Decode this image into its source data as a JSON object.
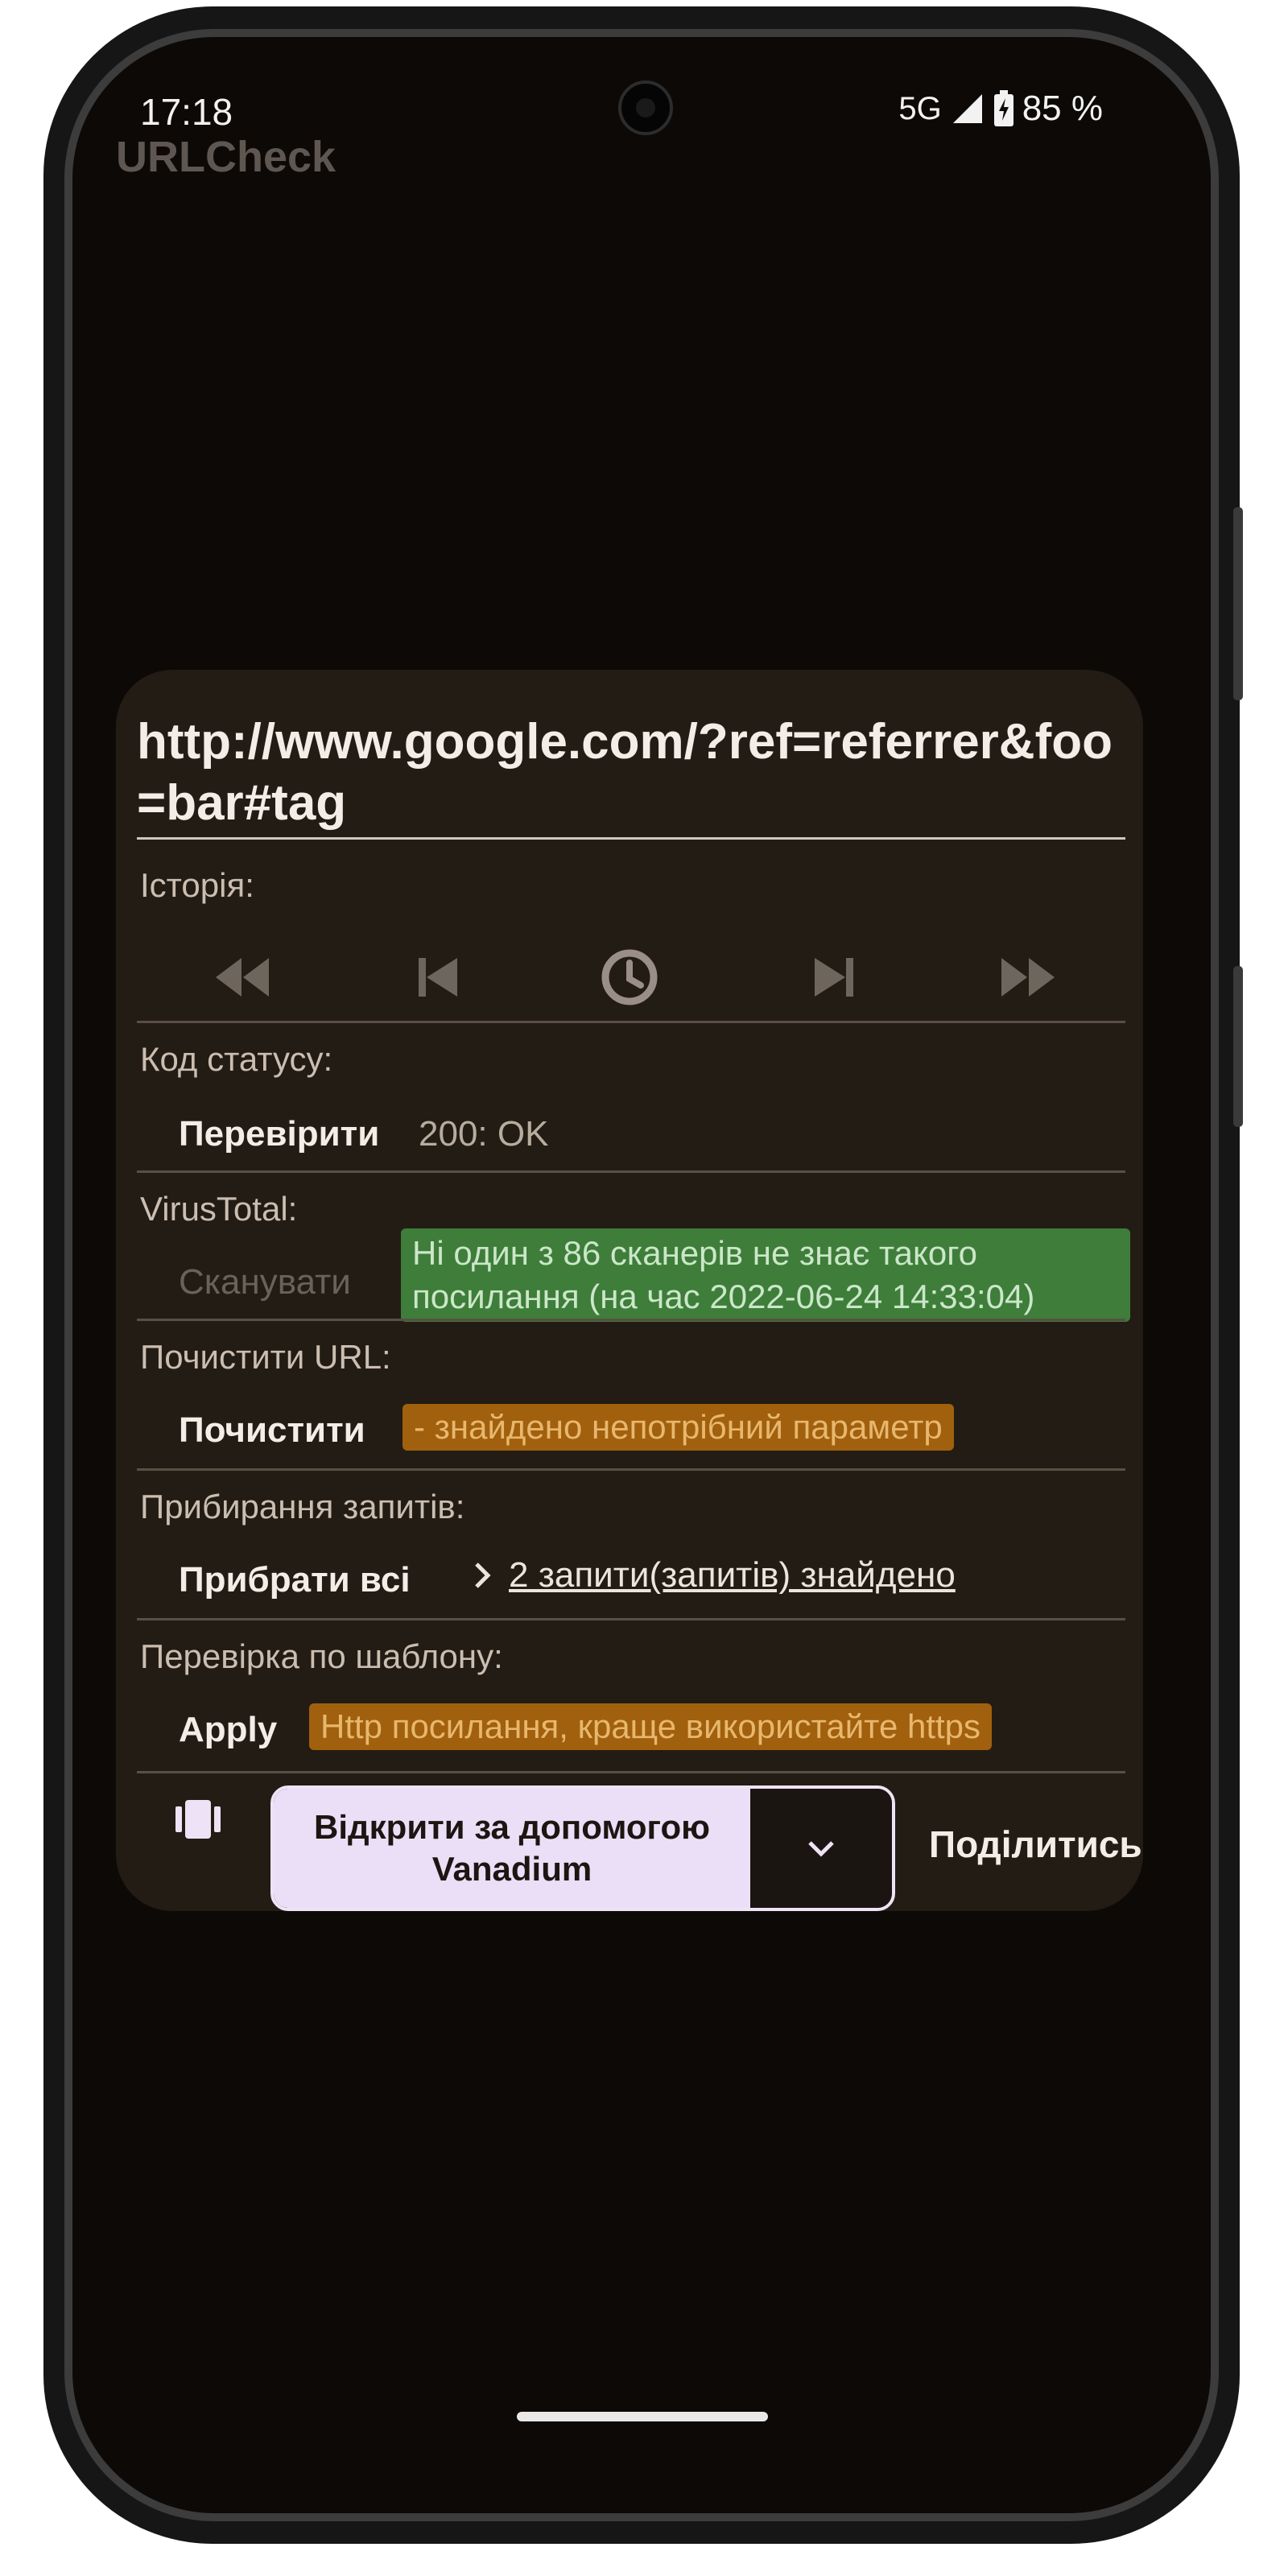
{
  "status_bar": {
    "time": "17:18",
    "network": "5G",
    "battery": "85 %"
  },
  "app": {
    "title": "URLCheck"
  },
  "dialog": {
    "url": "http://www.google.com/?ref=referrer&foo=bar#tag",
    "history": {
      "label": "Історія:",
      "icons": [
        "rewind-icon",
        "skip-previous-icon",
        "history-clock-icon",
        "skip-next-icon",
        "fast-forward-icon"
      ]
    },
    "status_code": {
      "label": "Код статусу:",
      "button": "Перевірити",
      "value": "200: OK"
    },
    "virustotal": {
      "label": "VirusTotal:",
      "button": "Сканувати",
      "result": "Ні один з 86 сканерів не знає такого посилання (на час 2022-06-24 14:33:04)"
    },
    "clear_url": {
      "label": "Почистити URL:",
      "button": "Почистити",
      "result": "- знайдено непотрібний параметр"
    },
    "remove_queries": {
      "label": "Прибирання запитів:",
      "button": "Прибрати всі",
      "link": "2 запити(запитів) знайдено"
    },
    "pattern_check": {
      "label": "Перевірка по шаблону:",
      "button": "Apply",
      "result": "Http посилання, краще використайте https"
    },
    "actions": {
      "open_with": "Відкрити за допомогою Vanadium",
      "share": "Поділитись"
    }
  },
  "colors": {
    "background": "#0d0907",
    "dialog": "#231c14",
    "green_tag": "#3e7d3a",
    "orange_tag": "#a1600d",
    "open_button": "#ebdff7"
  }
}
